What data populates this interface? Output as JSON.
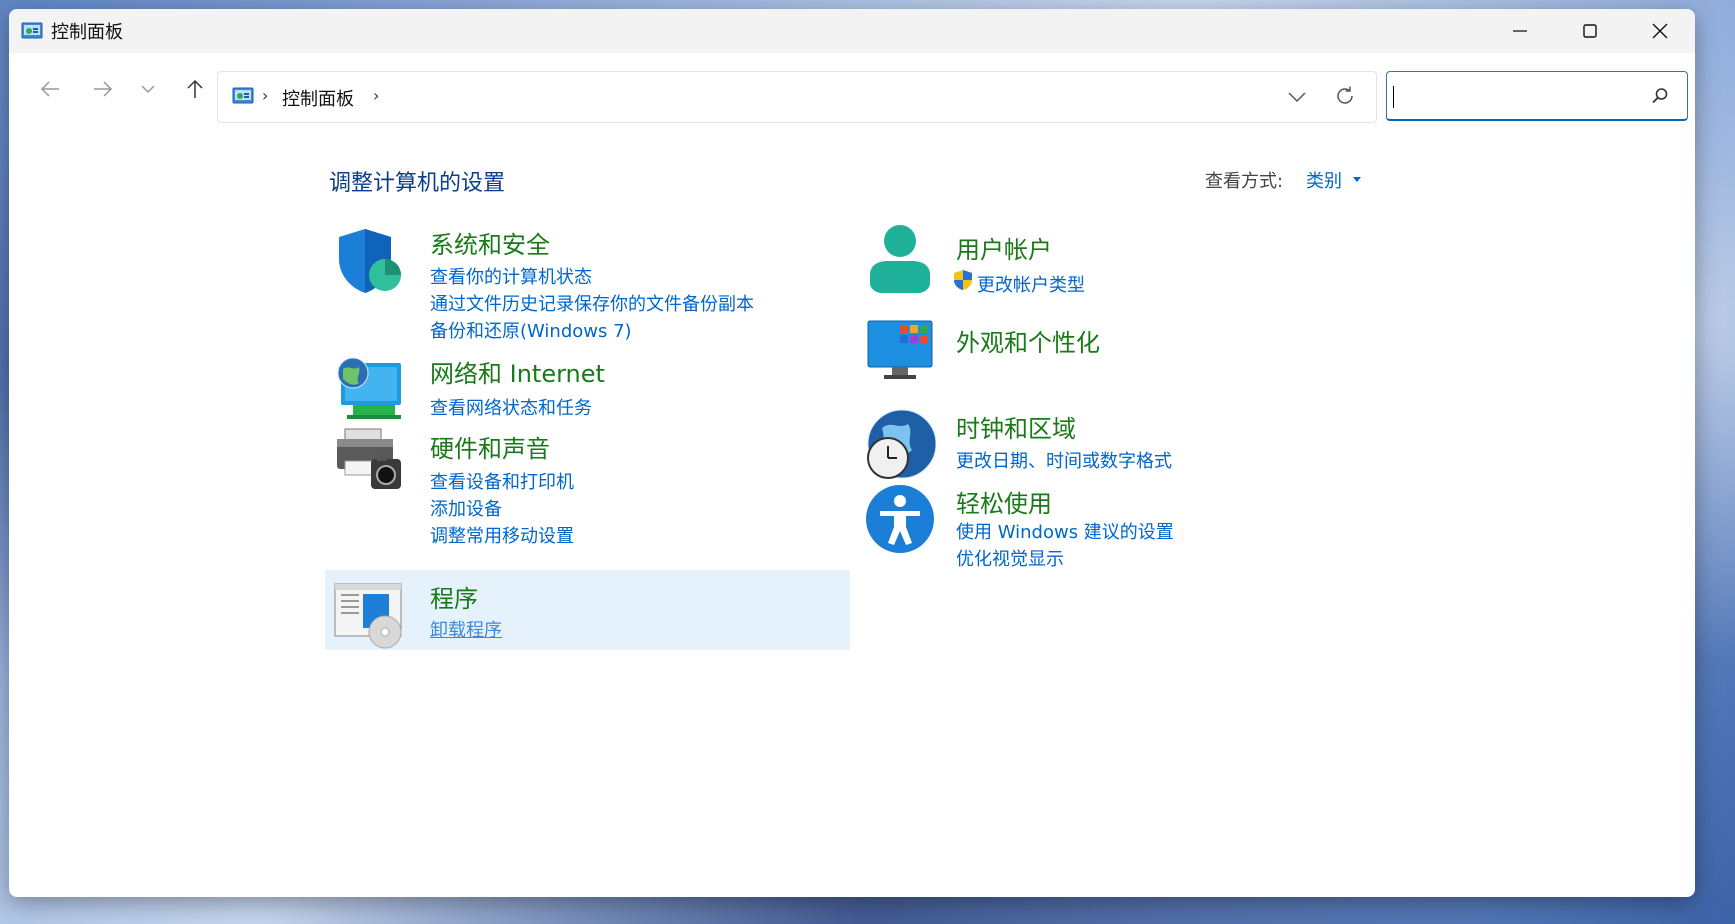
{
  "window": {
    "title": "控制面板"
  },
  "address_bar": {
    "path": [
      "控制面板"
    ],
    "separator": "›"
  },
  "search": {
    "placeholder": "",
    "value": ""
  },
  "header": {
    "title": "调整计算机的设置",
    "view_by_label": "查看方式:",
    "view_by_value": "类别"
  },
  "categories": [
    {
      "title": "系统和安全",
      "icon": "security-shield-icon",
      "links": [
        "查看你的计算机状态",
        "通过文件历史记录保存你的文件备份副本",
        "备份和还原(Windows 7)"
      ]
    },
    {
      "title": "网络和 Internet",
      "icon": "network-globe-icon",
      "links": [
        "查看网络状态和任务"
      ]
    },
    {
      "title": "硬件和声音",
      "icon": "printer-camera-icon",
      "links": [
        "查看设备和打印机",
        "添加设备",
        "调整常用移动设置"
      ]
    },
    {
      "title": "程序",
      "icon": "programs-disc-icon",
      "links": [
        "卸载程序"
      ]
    },
    {
      "title": "用户帐户",
      "icon": "user-icon",
      "links": [
        "更改帐户类型"
      ]
    },
    {
      "title": "外观和个性化",
      "icon": "monitor-tiles-icon",
      "links": []
    },
    {
      "title": "时钟和区域",
      "icon": "clock-globe-icon",
      "links": [
        "更改日期、时间或数字格式"
      ]
    },
    {
      "title": "轻松使用",
      "icon": "accessibility-icon",
      "links": [
        "使用 Windows 建议的设置",
        "优化视觉显示"
      ]
    }
  ],
  "colors": {
    "category_title": "#1a7a1a",
    "link": "#0066cc",
    "page_title": "#0a3d8c",
    "highlight": "#e5f1fb"
  }
}
